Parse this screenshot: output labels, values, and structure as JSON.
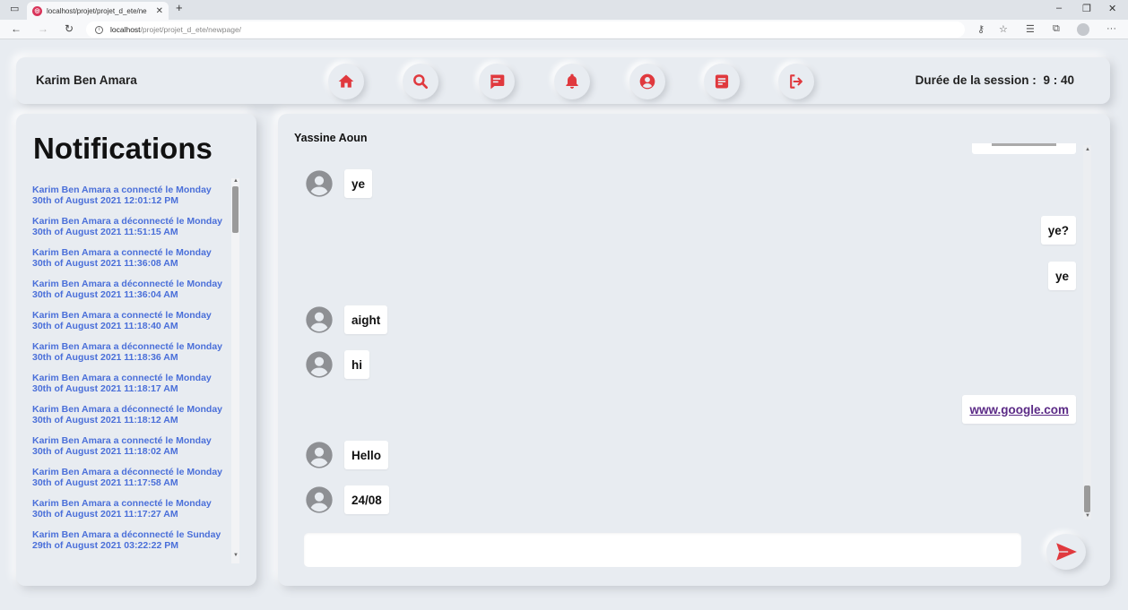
{
  "browser": {
    "tab_title": "localhost/projet/projet_d_ete/ne",
    "url_host": "localhost",
    "url_path": "/projet/projet_d_ete/newpage/"
  },
  "header": {
    "user_name": "Karim Ben Amara",
    "session_label": "Durée de la session :",
    "session_time": "9 : 40",
    "nav_icons": [
      "home-icon",
      "search-icon",
      "message-icon",
      "bell-icon",
      "user-circle-icon",
      "document-icon",
      "logout-icon"
    ],
    "accent_color": "#e0393e"
  },
  "notifications": {
    "title": "Notifications",
    "items": [
      "Karim Ben Amara a connecté le Monday 30th of August 2021 12:01:12 PM",
      "Karim Ben Amara a déconnecté le Monday 30th of August 2021 11:51:15 AM",
      "Karim Ben Amara a connecté le Monday 30th of August 2021 11:36:08 AM",
      "Karim Ben Amara a déconnecté le Monday 30th of August 2021 11:36:04 AM",
      "Karim Ben Amara a connecté le Monday 30th of August 2021 11:18:40 AM",
      "Karim Ben Amara a déconnecté le Monday 30th of August 2021 11:18:36 AM",
      "Karim Ben Amara a connecté le Monday 30th of August 2021 11:18:17 AM",
      "Karim Ben Amara a déconnecté le Monday 30th of August 2021 11:18:12 AM",
      "Karim Ben Amara a connecté le Monday 30th of August 2021 11:18:02 AM",
      "Karim Ben Amara a déconnecté le Monday 30th of August 2021 11:17:58 AM",
      "Karim Ben Amara a connecté le Monday 30th of August 2021 11:17:27 AM",
      "Karim Ben Amara a déconnecté le Sunday 29th of August 2021 03:22:22 PM"
    ],
    "link_color": "#4a6fd9"
  },
  "chat": {
    "contact_name": "Yassine Aoun",
    "messages": [
      {
        "text": "ye",
        "from": "other"
      },
      {
        "text": "ye?",
        "from": "me"
      },
      {
        "text": "ye",
        "from": "me"
      },
      {
        "text": "aight",
        "from": "other"
      },
      {
        "text": "hi",
        "from": "other"
      },
      {
        "text": "www.google.com",
        "from": "me",
        "link": true
      },
      {
        "text": "Hello",
        "from": "other"
      },
      {
        "text": "24/08",
        "from": "other"
      }
    ],
    "input_value": "",
    "send_icon": "send-icon"
  }
}
